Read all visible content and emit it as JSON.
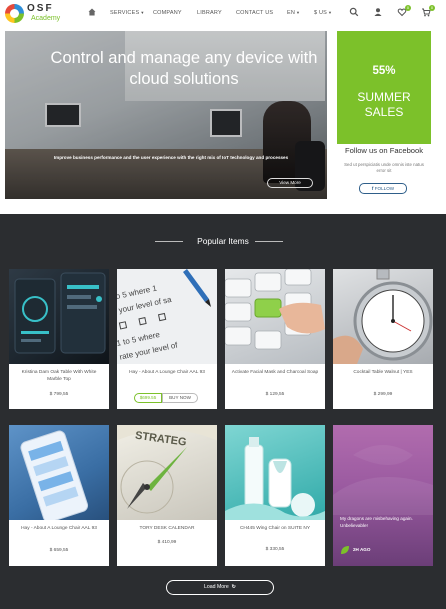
{
  "brand": {
    "name": "OSF",
    "sub": "Academy"
  },
  "nav": {
    "services": "SERVICES",
    "company": "COMPANY",
    "library": "LIBRARY",
    "contact": "CONTACT US",
    "language": "EN",
    "currency": "$ US",
    "wishlist_count": "0",
    "cart_count": "0"
  },
  "hero": {
    "title": "Control and manage any device with cloud solutions",
    "subtitle": "Improve business performance and the user experience with the right mix of IoT technology and processes",
    "button": "View More"
  },
  "promo": {
    "percent": "55%",
    "text": "SUMMER SALES"
  },
  "social": {
    "title": "Follow us on Facebook",
    "desc": "Sed ut perspiciatis unde omnis iste natus error sit",
    "button": "FOLLOW"
  },
  "popular": {
    "title": "Popular Items",
    "products": [
      {
        "title": "Kristina Dam Oak Table With White Marble Top",
        "price": "$ 799,55",
        "image": "phone-app-dark"
      },
      {
        "title": "Hay - About A Lounge Chair AAL 93",
        "price_button": "$699.55",
        "buy_button": "BUY NOW",
        "image": "survey-form"
      },
      {
        "title": "Activate Facial Mask and Charcoal Soap",
        "price": "$ 129,55",
        "image": "keyboard"
      },
      {
        "title": "Cocktail Table Walnut | YES",
        "price": "$ 299,99",
        "image": "stopwatch"
      },
      {
        "title": "Hay - About A Lounge Chair AAL 93",
        "price": "$ 659,55",
        "image": "phone-app-blue"
      },
      {
        "title": "TORY DESK CALENDAR",
        "price": "$ 410,99",
        "image": "compass-strategy"
      },
      {
        "title": "CH445 Wing Chair on SUITE NY",
        "price": "$ 330,55",
        "image": "cosmetics"
      }
    ],
    "promo_card": {
      "text": "My dragons are misbehaving again. Unbelievable!",
      "ago": "2H AGO"
    },
    "load_more": "Load More"
  }
}
